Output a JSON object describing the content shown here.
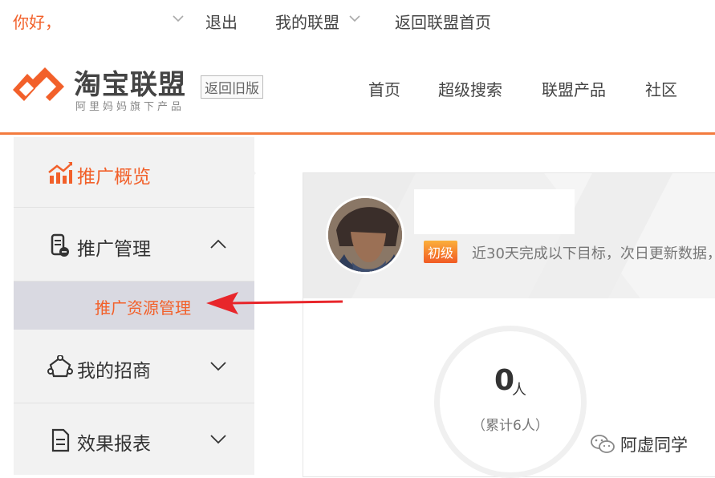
{
  "topbar": {
    "greeting": "你好，",
    "logout": "退出",
    "my_union": "我的联盟",
    "back_home": "返回联盟首页"
  },
  "header": {
    "logo_name": "淘宝联盟",
    "logo_sub": "阿里妈妈旗下产品",
    "old_version": "返回旧版",
    "nav": [
      "首页",
      "超级搜索",
      "联盟产品",
      "社区"
    ]
  },
  "sidebar": {
    "items": [
      {
        "label": "推广概览",
        "icon": "chart-icon",
        "active": true
      },
      {
        "label": "推广管理",
        "icon": "promo-icon",
        "expanded": true
      },
      {
        "label": "我的招商",
        "icon": "merchant-icon",
        "expanded": false
      },
      {
        "label": "效果报表",
        "icon": "report-icon",
        "expanded": false
      }
    ],
    "sub_item": "推广资源管理"
  },
  "profile": {
    "level_badge": "初级",
    "level_text": "近30天完成以下目标，次日更新数据，"
  },
  "stat": {
    "value": "0",
    "unit": "人",
    "total": "（累计6人）"
  },
  "watermark": "阿虚同学",
  "colors": {
    "accent": "#f2602a",
    "header_line": "#f37b3e",
    "sidebar_bg": "#f2f2f2",
    "sub_active_bg": "#d9d9e1",
    "callout_red": "#e8262b"
  }
}
